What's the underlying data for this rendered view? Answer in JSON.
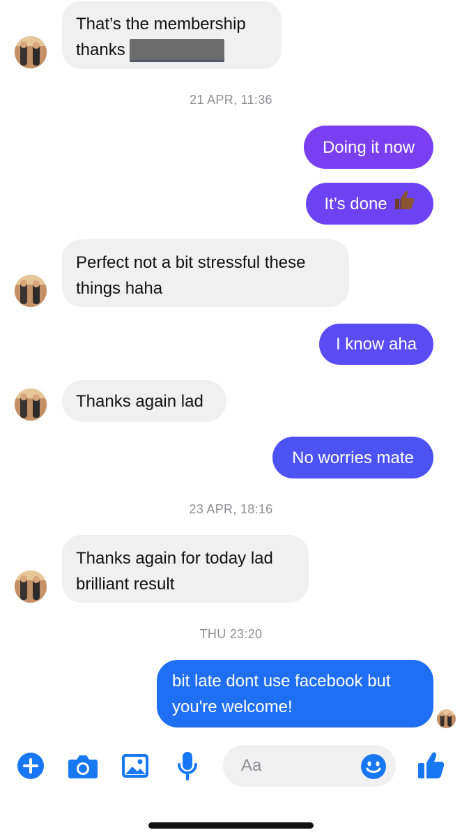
{
  "messages": [
    {
      "lines": [
        "That’s the membership",
        "thanks"
      ],
      "redacted": true
    },
    {
      "timestamp": "21 APR, 11:36"
    },
    {
      "text": "Doing it now"
    },
    {
      "text": "It’s done",
      "emoji": "thumbs-up-emoji"
    },
    {
      "lines": [
        "Perfect not a bit stressful these",
        "things haha"
      ]
    },
    {
      "text": "I know aha"
    },
    {
      "text": "Thanks again lad"
    },
    {
      "text": "No worries mate"
    },
    {
      "timestamp": "23 APR, 18:16"
    },
    {
      "lines": [
        "Thanks again for today lad",
        "brilliant result"
      ]
    },
    {
      "timestamp": "THU 23:20"
    },
    {
      "lines": [
        "bit late dont use facebook but",
        "you're welcome!"
      ]
    }
  ],
  "composer": {
    "placeholder": "Aa"
  },
  "toolbar": {
    "icons": [
      "plus-icon",
      "camera-icon",
      "image-icon",
      "microphone-icon",
      "emoji-icon",
      "thumbs-up-icon"
    ]
  },
  "colors": {
    "accent": "#1877f2",
    "bubble_in": "#f0f0f0",
    "bubble_out_top": "#7b3ff2",
    "bubble_out_mid": "#5a4cf5",
    "bubble_out_bottom": "#1f6ff5",
    "timestamp": "#8e8e93"
  }
}
